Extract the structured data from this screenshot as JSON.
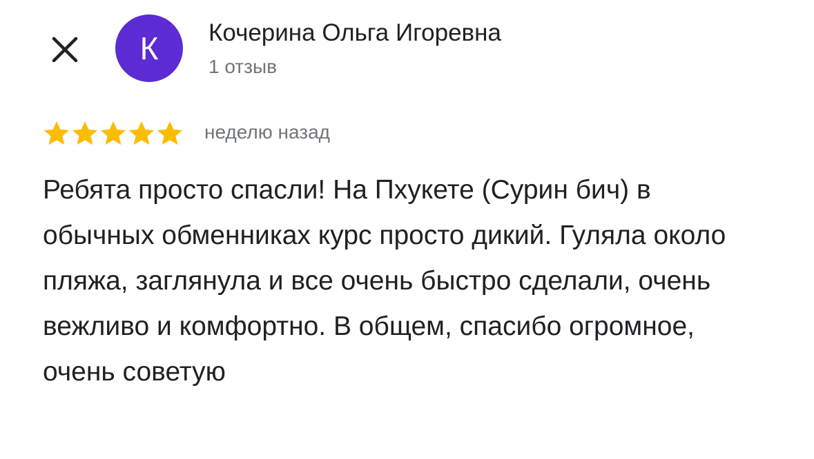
{
  "colors": {
    "avatar_bg": "#5c2bd3",
    "star": "#fbbc04",
    "text_primary": "#202124",
    "text_secondary": "#70757a"
  },
  "header": {
    "close_icon": "close-icon",
    "avatar_letter": "К",
    "author_name": "Кочерина Ольга Игоревна",
    "review_count": "1 отзыв"
  },
  "review": {
    "rating": 5,
    "rating_max": 5,
    "star_icon": "star-icon",
    "time": "неделю назад",
    "text": "Ребята просто спасли! На Пхукете (Сурин бич) в обычных обменниках курс просто дикий. Гуляла около пляжа, заглянула и все очень быстро сделали, очень вежливо и комфортно. В общем, спасибо огромное, очень советую"
  }
}
